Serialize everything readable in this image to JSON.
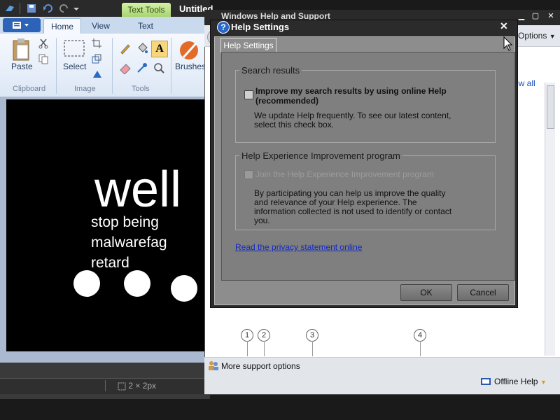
{
  "paint": {
    "title": "Untitled",
    "contextual_tab": "Text Tools",
    "tabs": [
      "Home",
      "View",
      "Text"
    ],
    "groups": {
      "clipboard": "Clipboard",
      "image": "Image",
      "tools": "Tools"
    },
    "tools": {
      "paste": "Paste",
      "select": "Select",
      "brushes": "Brushes"
    },
    "canvas_text": {
      "big": "well",
      "lines": [
        "stop being",
        "malwarefag",
        "retard"
      ]
    },
    "status_size": "2 × 2px"
  },
  "help_window": {
    "title": "Windows Help and Support",
    "options": "Options",
    "show_all": "ow all",
    "step_numbers": [
      "1",
      "2",
      "3",
      "4"
    ],
    "more_support": "More support options",
    "offline_help": "Offline Help"
  },
  "dialog": {
    "title": "Help Settings",
    "tab": "Help Settings",
    "search_group": {
      "title": "Search results",
      "checkbox_label": "Improve my search results by using online Help (recommended)",
      "description": "We update Help frequently. To see our latest content, select this check box."
    },
    "experience_group": {
      "title": "Help Experience Improvement program",
      "checkbox_label": "Join the Help Experience Improvement program",
      "description": "By participating you can help us improve the quality and relevance of your Help experience. The information collected is not used to identify or contact you."
    },
    "privacy_link": "Read the privacy statement online",
    "ok": "OK",
    "cancel": "Cancel"
  }
}
